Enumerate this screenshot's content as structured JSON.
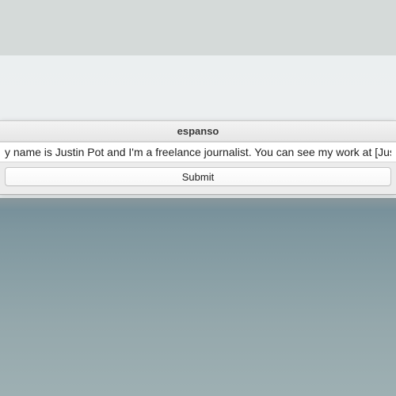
{
  "window": {
    "title": "espanso",
    "input_value": "y name is Justin Pot and I'm a freelance journalist. You can see my work at [JustinPo",
    "submit_label": "Submit"
  }
}
